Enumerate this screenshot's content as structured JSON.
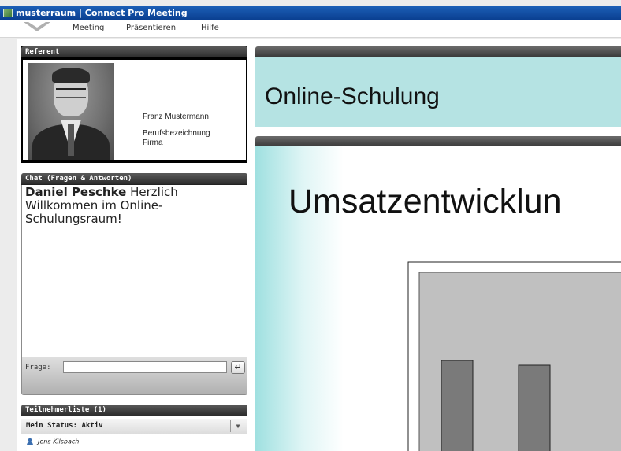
{
  "window": {
    "title": "musterraum | Connect Pro Meeting"
  },
  "menu": {
    "items": [
      "Meeting",
      "Präsentieren",
      "Hilfe"
    ]
  },
  "referent": {
    "header": "Referent",
    "name": "Franz Mustermann",
    "job": "Berufsbezeichnung",
    "company": "Firma"
  },
  "chat": {
    "header": "Chat (Fragen & Antworten)",
    "messages": [
      {
        "author": "Daniel Peschke",
        "text": "Herzlich Willkommen im Online-Schulungsraum!"
      }
    ],
    "input_label": "Frage:",
    "input_value": "",
    "send_symbol": "↵"
  },
  "participants": {
    "header": "Teilnehmerliste (1)",
    "status": "Mein Status: Aktiv",
    "list": [
      "Jens Kilsbach"
    ]
  },
  "slide_title": "Online-Schulung",
  "slide": {
    "heading": "Umsatzentwicklun",
    "colors": {
      "bar": "#7a7a7a",
      "plot_bg": "#c0c0c0",
      "accent": "#b5e3e3"
    }
  },
  "icons": {
    "app": "app-icon",
    "menu": "chevron-down-icon",
    "send": "enter-icon",
    "participant": "user-icon"
  }
}
